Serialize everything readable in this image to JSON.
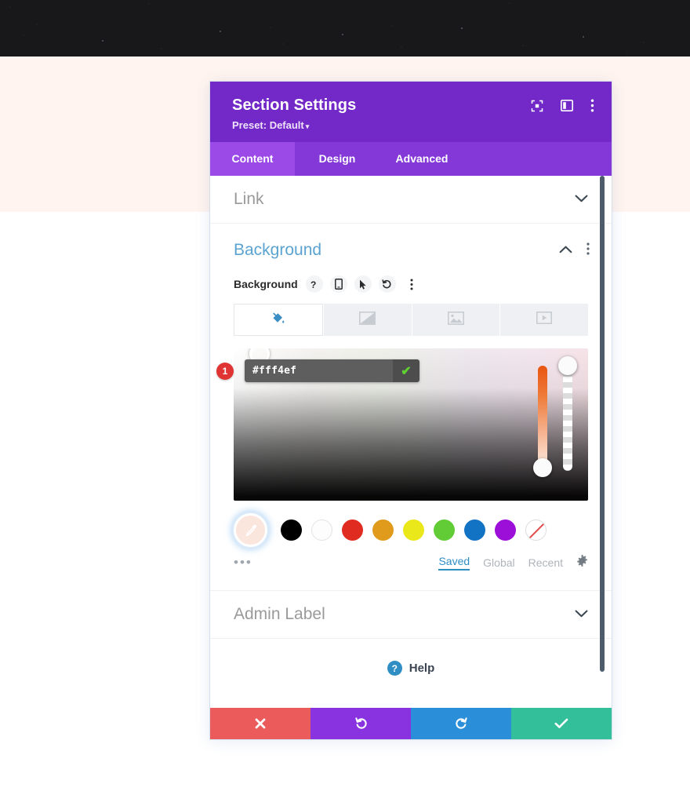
{
  "page": {
    "background_color": "#fff4ef",
    "banner_color": "#18171a"
  },
  "modal": {
    "title": "Section Settings",
    "preset_label": "Preset: Default",
    "preset_caret": "▾",
    "header_icons": [
      {
        "name": "focus-icon",
        "glyph": "target"
      },
      {
        "name": "layout-panel-icon",
        "glyph": "panel"
      },
      {
        "name": "more-options-icon",
        "glyph": "kebab"
      }
    ],
    "tabs": [
      {
        "label": "Content",
        "active": true
      },
      {
        "label": "Design",
        "active": false
      },
      {
        "label": "Advanced",
        "active": false
      }
    ],
    "accent_purple": "#7328c8",
    "tabbar_purple": "#8438d8"
  },
  "sections": {
    "link": {
      "label": "Link",
      "collapsed": true,
      "chevron": "▼"
    },
    "background": {
      "label": "Background",
      "collapsed": false,
      "chevron": "▲",
      "kebab": "⋮"
    },
    "admin_label": {
      "label": "Admin Label",
      "collapsed": true,
      "chevron": "▼"
    }
  },
  "background_field": {
    "label": "Background",
    "controls": [
      {
        "name": "help-icon",
        "glyph": "?"
      },
      {
        "name": "responsive-phone-icon",
        "glyph": "phone"
      },
      {
        "name": "hover-cursor-icon",
        "glyph": "cursor"
      },
      {
        "name": "reset-icon",
        "glyph": "undo"
      },
      {
        "name": "field-more-icon",
        "glyph": "⋮"
      }
    ],
    "type_tabs": [
      {
        "name": "background-color-tab",
        "icon": "paint-bucket-icon",
        "active": true
      },
      {
        "name": "background-gradient-tab",
        "icon": "gradient-icon",
        "active": false
      },
      {
        "name": "background-image-tab",
        "icon": "image-icon",
        "active": false
      },
      {
        "name": "background-video-tab",
        "icon": "video-icon",
        "active": false
      }
    ]
  },
  "color_picker": {
    "hex_value": "#fff4ef",
    "confirm_glyph": "✔",
    "step_badge": "1",
    "badge_color": "#e03434",
    "hue_slider_name": "hue-slider",
    "alpha_slider_name": "alpha-slider",
    "swatches": [
      {
        "name": "eyedropper-swatch",
        "color": "#fbe6dd",
        "kind": "eyedropper",
        "selected": true
      },
      {
        "name": "swatch-black",
        "color": "#000000",
        "kind": "solid"
      },
      {
        "name": "swatch-white",
        "color": "#ffffff",
        "kind": "white"
      },
      {
        "name": "swatch-red",
        "color": "#e02b20",
        "kind": "solid"
      },
      {
        "name": "swatch-orange",
        "color": "#e09b1c",
        "kind": "solid"
      },
      {
        "name": "swatch-yellow",
        "color": "#eae81b",
        "kind": "solid"
      },
      {
        "name": "swatch-green",
        "color": "#62cc36",
        "kind": "solid"
      },
      {
        "name": "swatch-blue",
        "color": "#1272c4",
        "kind": "solid"
      },
      {
        "name": "swatch-purple",
        "color": "#9b0fd9",
        "kind": "solid"
      },
      {
        "name": "swatch-transparent",
        "color": "transparent",
        "kind": "none"
      }
    ],
    "more_swatches": "•••",
    "palette_tabs": [
      {
        "label": "Saved",
        "active": true
      },
      {
        "label": "Global",
        "active": false
      },
      {
        "label": "Recent",
        "active": false
      }
    ],
    "palette_settings_icon": "gear-icon"
  },
  "help": {
    "label": "Help",
    "icon_glyph": "?"
  },
  "footer": {
    "buttons": [
      {
        "name": "cancel-button",
        "glyph": "✕",
        "color": "#eb5b5b"
      },
      {
        "name": "undo-button",
        "glyph": "↺",
        "color": "#8833df"
      },
      {
        "name": "redo-button",
        "glyph": "↻",
        "color": "#2a8fd8"
      },
      {
        "name": "save-button",
        "glyph": "✔",
        "color": "#34bf9b"
      }
    ]
  }
}
